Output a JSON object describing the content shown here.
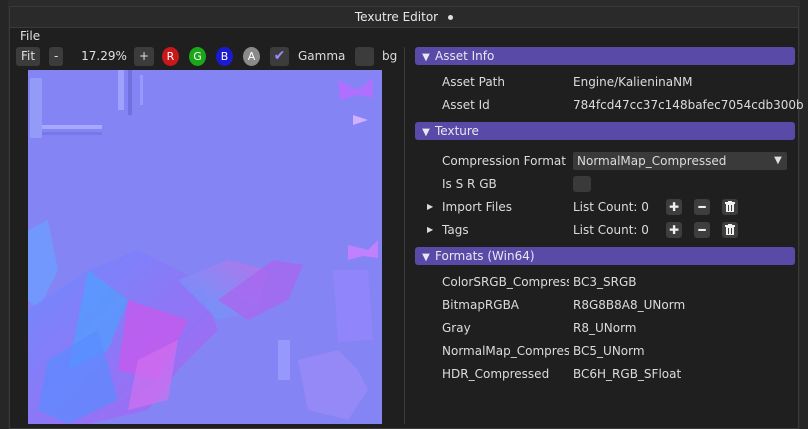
{
  "window": {
    "title": "Texutre Editor"
  },
  "menu": {
    "file": "File"
  },
  "toolbar": {
    "fit_label": "Fit",
    "zoom_out_label": "-",
    "zoom_value": "17.29%",
    "zoom_in_label": "+",
    "channels": [
      {
        "label": "R",
        "color": "#c8181a"
      },
      {
        "label": "G",
        "color": "#1aa81a"
      },
      {
        "label": "B",
        "color": "#1a1ad0"
      },
      {
        "label": "A",
        "color": "#8a8a8a"
      }
    ],
    "gamma_label": "Gamma",
    "bg_label": "bg",
    "gamma_checked": true,
    "bg_checked": false
  },
  "sections": {
    "asset_info": {
      "title": "Asset Info",
      "rows": [
        {
          "label": "Asset Path",
          "value": "Engine/KalieninaNM"
        },
        {
          "label": "Asset Id",
          "value": "784fcd47cc37c148bafec7054cdb300b"
        }
      ]
    },
    "texture": {
      "title": "Texture",
      "compression_format_label": "Compression Format",
      "compression_format_value": "NormalMap_Compressed",
      "is_srgb_label": "Is S R GB",
      "is_srgb_checked": false,
      "import_files_label": "Import Files",
      "import_files_value": "List Count: 0",
      "tags_label": "Tags",
      "tags_value": "List Count: 0"
    },
    "formats": {
      "title": "Formats (Win64)",
      "rows": [
        {
          "label": "ColorSRGB_Compress",
          "value": "BC3_SRGB"
        },
        {
          "label": "BitmapRGBA",
          "value": "R8G8B8A8_UNorm"
        },
        {
          "label": "Gray",
          "value": "R8_UNorm"
        },
        {
          "label": "NormalMap_Compres",
          "value": "BC5_UNorm"
        },
        {
          "label": "HDR_Compressed",
          "value": "BC6H_RGB_SFloat"
        }
      ]
    }
  },
  "colors": {
    "header": "#5a4aa8",
    "normal_map_base": "#8484f4",
    "window_bg": "#1f1f1f"
  }
}
